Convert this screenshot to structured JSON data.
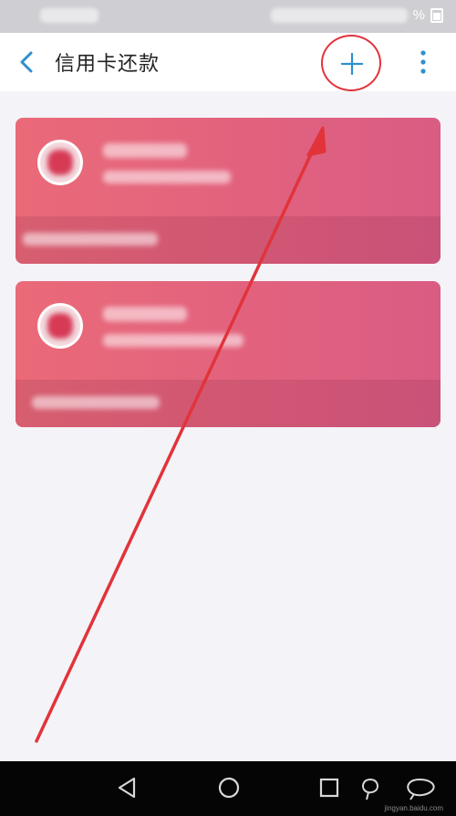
{
  "header": {
    "title": "信用卡还款",
    "back_icon": "chevron-left-icon",
    "add_icon": "plus-icon",
    "more_icon": "more-vertical-icon"
  },
  "status_bar": {
    "battery_percent_symbol": "%"
  },
  "cards": [
    {
      "logo_icon": "bank-logo-icon"
    },
    {
      "logo_icon": "bank-logo-icon"
    }
  ],
  "nav": {
    "back_icon": "triangle-back-icon",
    "home_icon": "circle-home-icon",
    "recents_icon": "square-recents-icon"
  },
  "watermark": "jingyan.baidu.com",
  "colors": {
    "accent": "#2f8fd0",
    "card": "#e2627e",
    "annotation": "#e2333b",
    "header_bg": "#ffffff",
    "page_bg": "#f4f3f8"
  }
}
